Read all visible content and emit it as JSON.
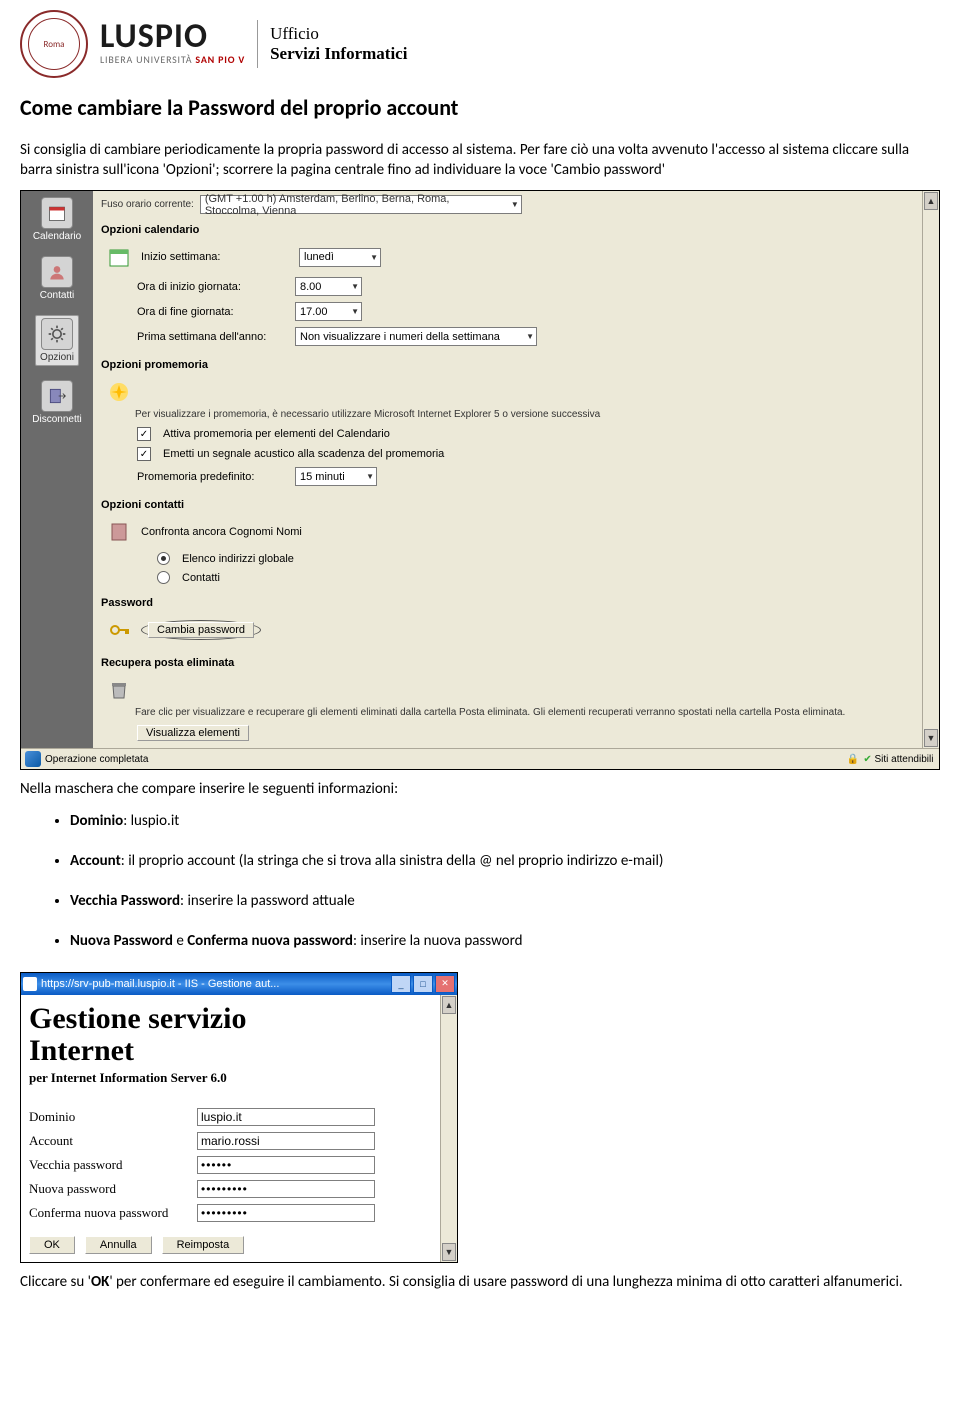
{
  "header": {
    "logo_name": "LUSPIO",
    "subtitle_plain": "LIBERA UNIVERSITÀ ",
    "subtitle_red": "SAN PIO V",
    "office_l1": "Ufficio",
    "office_l2": "Servizi Informatici"
  },
  "doc": {
    "title": "Come cambiare la Password del proprio account",
    "p1": "Si consiglia di cambiare periodicamente la propria password di accesso al sistema. Per fare ciò una volta avvenuto l'accesso al sistema cliccare sulla barra sinistra sull'icona 'Opzioni'; scorrere la pagina centrale fino ad individuare la voce 'Cambio password'",
    "p2": "Nella maschera che compare inserire le seguenti informazioni:",
    "bullets": {
      "b1_label": "Dominio",
      "b1_text": ": luspio.it",
      "b2_label": "Account",
      "b2_text": ": il proprio account (la stringa che si trova alla sinistra della @ nel proprio indirizzo e-mail)",
      "b3_label": "Vecchia Password",
      "b3_text": ": inserire la password attuale",
      "b4_label": "Nuova Password",
      "b4_mid": " e ",
      "b4_label2": "Conferma nuova password",
      "b4_text": ": inserire la nuova password"
    },
    "p3a": "Cliccare su '",
    "p3b": "OK",
    "p3c": "' per confermare ed eseguire il cambiamento. Si consiglia di usare password di una lunghezza minima di otto caratteri alfanumerici."
  },
  "shot1": {
    "topbar_label": "Fuso orario corrente:",
    "topbar_value": "(GMT +1.00 h) Amsterdam, Berlino, Berna, Roma, Stoccolma, Vienna",
    "sidebar": {
      "item1": "Calendario",
      "item2": "Contatti",
      "item3": "Opzioni",
      "item4": "Disconnetti"
    },
    "sec1": "Opzioni calendario",
    "cal": {
      "r1": "Inizio settimana:",
      "r1v": "lunedì",
      "r2": "Ora di inizio giornata:",
      "r2v": "8.00",
      "r3": "Ora di fine giornata:",
      "r3v": "17.00",
      "r4": "Prima settimana dell'anno:",
      "r4v": "Non visualizzare i numeri della settimana"
    },
    "sec2": "Opzioni promemoria",
    "pro": {
      "note": "Per visualizzare i promemoria, è necessario utilizzare Microsoft Internet Explorer 5 o versione successiva",
      "cb1": "Attiva promemoria per elementi del Calendario",
      "cb2": "Emetti un segnale acustico alla scadenza del promemoria",
      "r1": "Promemoria predefinito:",
      "r1v": "15 minuti"
    },
    "sec3": "Opzioni contatti",
    "con": {
      "line": "Confronta ancora Cognomi Nomi",
      "rb1": "Elenco indirizzi globale",
      "rb2": "Contatti"
    },
    "sec4": "Password",
    "pwd_btn": "Cambia password",
    "sec5": "Recupera posta eliminata",
    "rec": {
      "note": "Fare clic per visualizzare e recuperare gli elementi eliminati dalla cartella Posta eliminata. Gli elementi recuperati verranno spostati nella cartella Posta eliminata.",
      "btn": "Visualizza elementi"
    },
    "status_left": "Operazione completata",
    "status_right": "Siti attendibili"
  },
  "shot2": {
    "titlebar": "https://srv-pub-mail.luspio.it - IIS - Gestione aut...",
    "h1a": "Gestione servizio",
    "h1b": "Internet",
    "sub": "per Internet Information Server 6.0",
    "f": {
      "l1": "Dominio",
      "v1": "luspio.it",
      "l2": "Account",
      "v2": "mario.rossi",
      "l3": "Vecchia password",
      "v3": "••••••",
      "l4": "Nuova password",
      "v4": "•••••••••",
      "l5": "Conferma nuova password",
      "v5": "•••••••••"
    },
    "btn_ok": "OK",
    "btn_cancel": "Annulla",
    "btn_reset": "Reimposta"
  }
}
